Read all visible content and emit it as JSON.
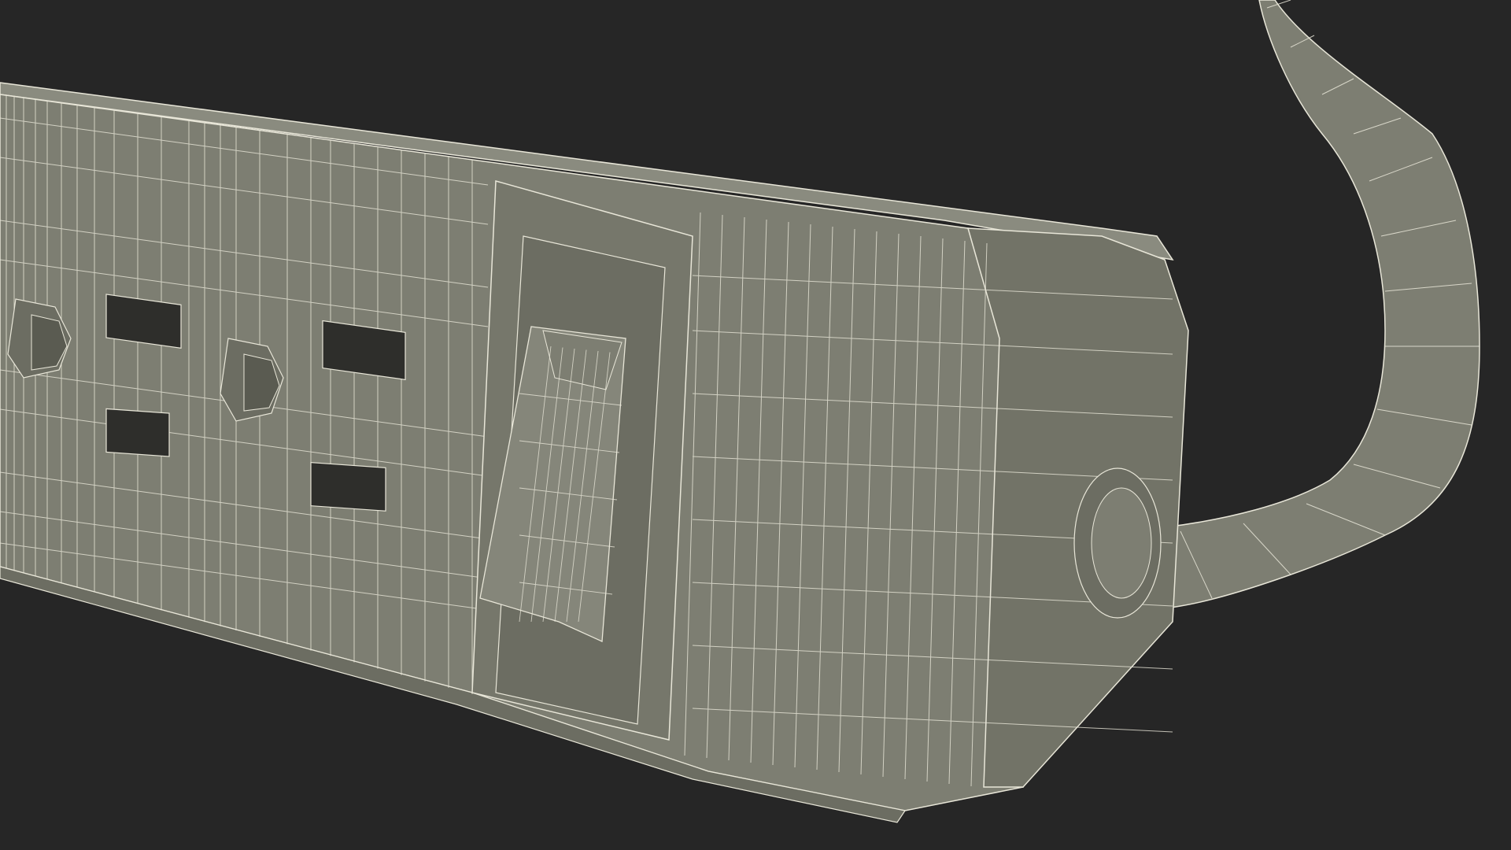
{
  "scene": {
    "subject": "power-strip-wireframe-render",
    "colors": {
      "background": "#262626",
      "body": "#7d7e72",
      "body_dark": "#6c6d62",
      "body_shadow": "#5a5b51",
      "slot": "#2e2e2b",
      "wire": "#e8e6d8"
    },
    "parts": {
      "strip_body": "strip-body",
      "outlets": [
        "outlet-1",
        "outlet-2"
      ],
      "switch": "rocker-switch",
      "end_cap": "end-cap",
      "cord": "power-cord"
    }
  }
}
